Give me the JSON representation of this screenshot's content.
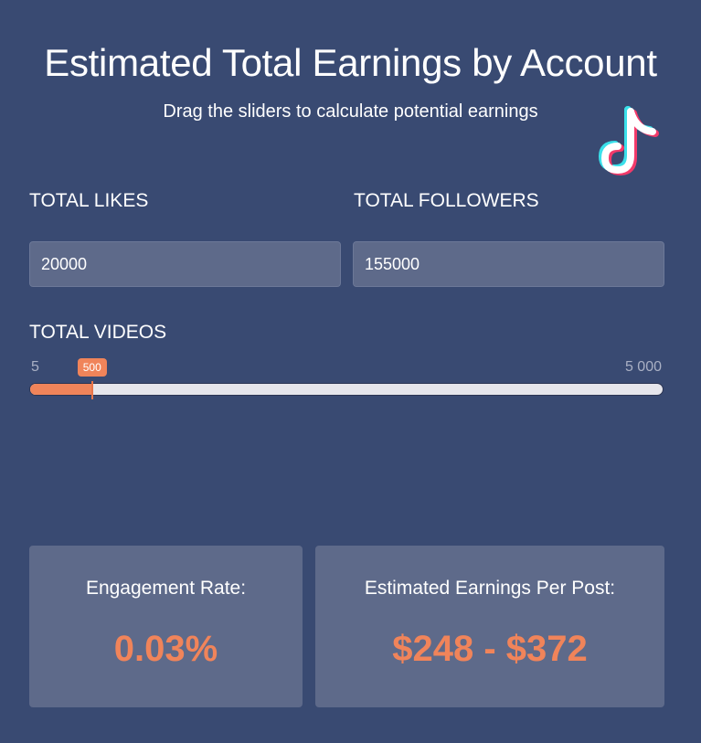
{
  "header": {
    "title": "Estimated Total Earnings by Account",
    "subtitle": "Drag the sliders to calculate potential earnings",
    "logo_icon": "tiktok-logo-icon"
  },
  "inputs": {
    "likes": {
      "label": "TOTAL LIKES",
      "value": "20000"
    },
    "followers": {
      "label": "TOTAL FOLLOWERS",
      "value": "155000"
    }
  },
  "videos_slider": {
    "label": "TOTAL VIDEOS",
    "min_label": "5",
    "max_label": "5 000",
    "min": 5,
    "max": 5000,
    "value": 500,
    "value_label": "500"
  },
  "results": {
    "engagement": {
      "label": "Engagement Rate:",
      "value": "0.03%"
    },
    "earnings": {
      "label": "Estimated Earnings Per Post:",
      "value": "$248 - $372"
    }
  },
  "colors": {
    "background": "#394a72",
    "panel": "#5e6a8a",
    "accent": "#f0845a",
    "track": "#e6e6ec"
  }
}
